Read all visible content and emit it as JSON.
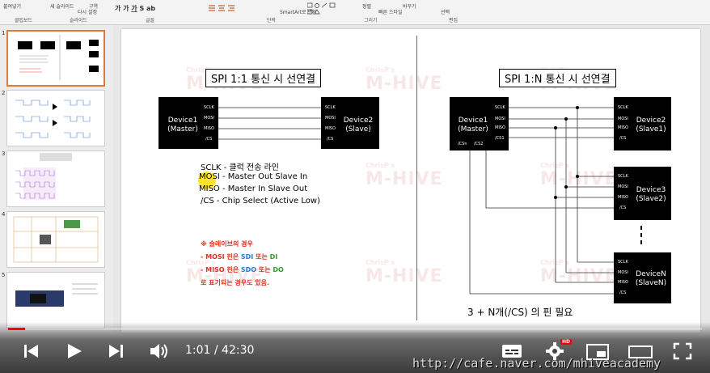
{
  "ribbon": {
    "groups": [
      "클립보드",
      "슬라이드",
      "글꼴",
      "단락",
      "그리기",
      "편집"
    ],
    "items": [
      "붙여넣기",
      "새 슬라이드",
      "다시 설정",
      "구역",
      "SmartArt로 변환",
      "정렬",
      "빠른 스타일",
      "바꾸기",
      "선택"
    ]
  },
  "thumbnails": {
    "numbers": [
      "1",
      "2",
      "3",
      "4",
      "5"
    ],
    "selected_index": 0
  },
  "slide": {
    "watermark_small": "ChrisP's",
    "watermark_big": "M-HIVE",
    "left": {
      "title": "SPI 1:1 통신 시 선연결",
      "master": {
        "name": "Device1\n(Master)",
        "pins": [
          "SCLK",
          "MOSI",
          "MISO",
          "/CS"
        ]
      },
      "slave": {
        "name": "Device2\n(Slave)",
        "pins": [
          "SCLK",
          "MOSI",
          "MISO",
          "/CS"
        ]
      },
      "legend": [
        "SCLK  -  클럭 전송 라인",
        "MOSI  -  Master Out Slave In",
        "MISO  -  Master In Slave Out",
        "  /CS  -  Chip Select (Active Low)"
      ],
      "notes": [
        {
          "text": "※ 슬레이브의 경우",
          "color": "#e0301e"
        },
        {
          "parts": [
            {
              "text": "- MOSI 핀은 ",
              "color": "#e0301e"
            },
            {
              "text": "SDI",
              "color": "#1e7fd6"
            },
            {
              "text": " 또는 ",
              "color": "#e0301e"
            },
            {
              "text": "DI",
              "color": "#2aa02a"
            }
          ]
        },
        {
          "parts": [
            {
              "text": "- MISO 핀은 ",
              "color": "#e0301e"
            },
            {
              "text": "SDO",
              "color": "#1e7fd6"
            },
            {
              "text": " 또는 ",
              "color": "#e0301e"
            },
            {
              "text": "DO",
              "color": "#2aa02a"
            }
          ]
        },
        {
          "text": "로 표기되는 경우도 있음.",
          "color": "#e0301e"
        }
      ]
    },
    "right": {
      "title": "SPI 1:N 통신 시 선연결",
      "master": {
        "name": "Device1\n(Master)",
        "pins": [
          "SCLK",
          "MOSI",
          "MISO",
          "/CS1"
        ],
        "cs_pins": [
          "/CSn",
          "/CS2"
        ]
      },
      "slaves": [
        {
          "name": "Device2\n(Slave1)",
          "pins": [
            "SCLK",
            "MOSI",
            "MISO",
            "/CS"
          ]
        },
        {
          "name": "Device3\n(Slave2)",
          "pins": [
            "SCLK",
            "MOSI",
            "MISO",
            "/CS"
          ]
        },
        {
          "name": "DeviceN\n(SlaveN)",
          "pins": [
            "SCLK",
            "MOSI",
            "MISO",
            "/CS"
          ]
        }
      ],
      "footer": "3 + N개(/CS) 의 핀 필요"
    }
  },
  "player": {
    "current_time": "1:01",
    "duration": "42:30",
    "time_label": "1:01 / 42:30",
    "progress": 0.024,
    "hd_badge": "HD",
    "url": "http://cafe.naver.com/mhiveacademy",
    "colors": {
      "progress": "#ff0000",
      "hd": "#ee0000",
      "selected_thumb": "#e07a3a"
    }
  }
}
